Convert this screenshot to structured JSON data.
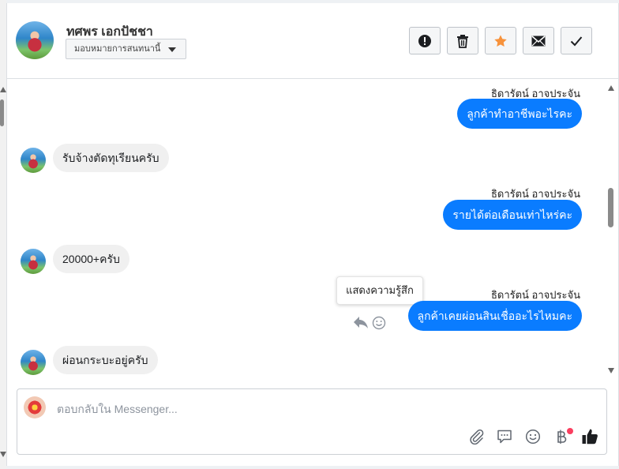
{
  "header": {
    "contact_name": "ทศพร เอกปัชชา",
    "assign_label": "มอบหมายการสนทนานี้",
    "actions": [
      {
        "name": "report-button",
        "icon": "exclamation-circle-icon"
      },
      {
        "name": "delete-button",
        "icon": "trash-icon"
      },
      {
        "name": "star-button",
        "icon": "star-icon",
        "color": "#f7923b"
      },
      {
        "name": "mark-unread-button",
        "icon": "envelope-icon"
      },
      {
        "name": "mark-done-button",
        "icon": "checkmark-icon"
      }
    ]
  },
  "messages": [
    {
      "direction": "out",
      "sender": "ธิดารัตน์ อาจประจัน",
      "text": "ลูกค้าทำอาชีพอะไรคะ"
    },
    {
      "direction": "in",
      "text": "รับจ้างตัดทุเรียนครับ"
    },
    {
      "direction": "out",
      "sender": "ธิดารัตน์ อาจประจัน",
      "text": "รายได้ต่อเดือนเท่าไหร่คะ"
    },
    {
      "direction": "in",
      "text": "20000+ครับ"
    },
    {
      "direction": "out",
      "sender": "ธิดารัตน์ อาจประจัน",
      "text": "ลูกค้าเคยผ่อนสินเชื่ออะไรไหมคะ"
    },
    {
      "direction": "in",
      "text": "ผ่อนกระบะอยู่ครับ"
    }
  ],
  "tooltip": "แสดงความรู้สึก",
  "composer": {
    "placeholder": "ตอบกลับใน Messenger...",
    "tools": [
      "paperclip-icon",
      "saved-reply-icon",
      "emoji-icon",
      "baht-icon",
      "thumbs-up-icon"
    ]
  },
  "colors": {
    "accent": "#0a7cff",
    "incoming_bubble": "#f0f0f0",
    "star": "#f7923b",
    "notification_dot": "#fa3e5f"
  }
}
